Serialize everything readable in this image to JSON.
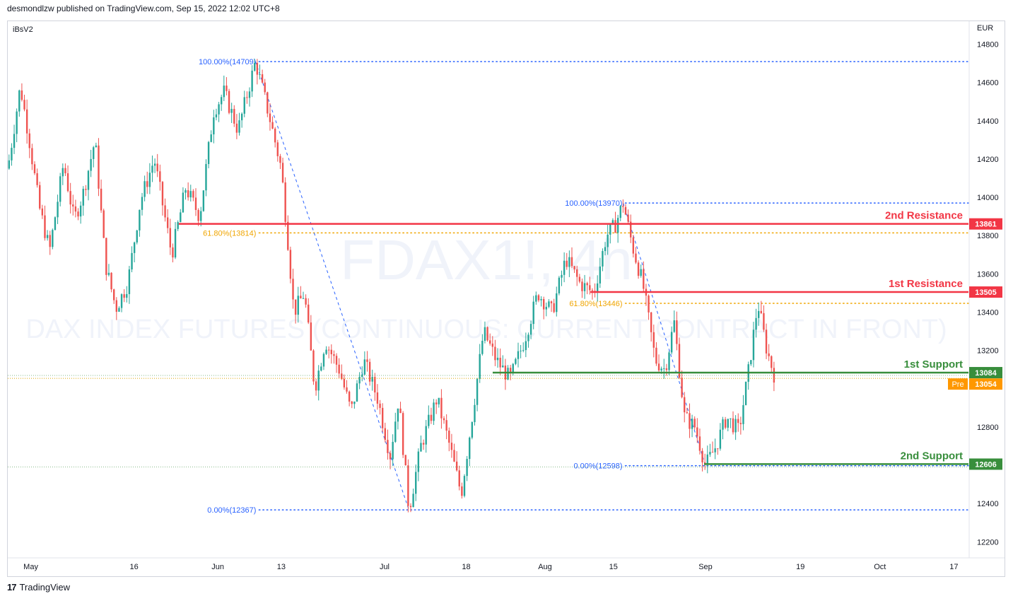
{
  "header": {
    "published": "desmondlzw published on TradingView.com, Sep 15, 2022 12:02 UTC+8"
  },
  "chart_meta": {
    "symbol_tag": "iBsV2",
    "currency": "EUR"
  },
  "watermark": {
    "ticker": "FDAX1!, 4h",
    "description": "DAX INDEX FUTURES (CONTINUOUS: CURRENT CONTRACT IN FRONT)"
  },
  "footer": {
    "brand": "TradingView",
    "logo_icon": "tradingview-logo-icon"
  },
  "colors": {
    "up": "#26a69a",
    "down": "#ef5350",
    "resistance": "#f23645",
    "support": "#388e3c",
    "fib": "#2962ff",
    "fib_mid": "#f0a500",
    "pre": "#ff9800",
    "pre_line": "#d9a400"
  },
  "chart_data": {
    "type": "candlestick",
    "ylim": [
      12120,
      14920
    ],
    "y_ticks": [
      12200,
      12400,
      12600,
      12800,
      13000,
      13200,
      13400,
      13600,
      13800,
      14000,
      14200,
      14400,
      14600,
      14800
    ],
    "y_tick_labels": [
      "12200",
      "12400",
      "12600",
      "12800",
      "",
      "13200",
      "13400",
      "13600",
      "13800",
      "14000",
      "14200",
      "14400",
      "14600",
      "14800"
    ],
    "x_labels": [
      {
        "label": "May",
        "t": 0.033
      },
      {
        "label": "16",
        "t": 0.181
      },
      {
        "label": "Jun",
        "t": 0.301
      },
      {
        "label": "13",
        "t": 0.392
      },
      {
        "label": "Jul",
        "t": 0.54
      },
      {
        "label": "18",
        "t": 0.657
      },
      {
        "label": "Aug",
        "t": 0.77
      },
      {
        "label": "15",
        "t": 0.868
      },
      {
        "label": "Sep",
        "t": 1.0
      },
      {
        "label": "19",
        "t": 1.136
      },
      {
        "label": "Oct",
        "t": 1.25
      },
      {
        "label": "17",
        "t": 1.356
      }
    ],
    "anchors": [
      [
        0.0,
        14150
      ],
      [
        0.018,
        14580
      ],
      [
        0.03,
        14320
      ],
      [
        0.045,
        13950
      ],
      [
        0.06,
        13720
      ],
      [
        0.08,
        14180
      ],
      [
        0.095,
        13880
      ],
      [
        0.108,
        14020
      ],
      [
        0.125,
        14300
      ],
      [
        0.14,
        13650
      ],
      [
        0.155,
        13420
      ],
      [
        0.172,
        13550
      ],
      [
        0.19,
        13980
      ],
      [
        0.21,
        14200
      ],
      [
        0.235,
        13700
      ],
      [
        0.255,
        14050
      ],
      [
        0.275,
        13900
      ],
      [
        0.295,
        14450
      ],
      [
        0.31,
        14550
      ],
      [
        0.33,
        14350
      ],
      [
        0.355,
        14709
      ],
      [
        0.375,
        14420
      ],
      [
        0.392,
        14150
      ],
      [
        0.402,
        13750
      ],
      [
        0.41,
        13400
      ],
      [
        0.425,
        13500
      ],
      [
        0.44,
        13000
      ],
      [
        0.455,
        13250
      ],
      [
        0.475,
        13100
      ],
      [
        0.492,
        12880
      ],
      [
        0.51,
        13150
      ],
      [
        0.53,
        12950
      ],
      [
        0.548,
        12650
      ],
      [
        0.56,
        12950
      ],
      [
        0.575,
        12367
      ],
      [
        0.592,
        12700
      ],
      [
        0.615,
        12950
      ],
      [
        0.632,
        12720
      ],
      [
        0.65,
        12450
      ],
      [
        0.668,
        12920
      ],
      [
        0.682,
        13300
      ],
      [
        0.7,
        13150
      ],
      [
        0.72,
        13050
      ],
      [
        0.74,
        13250
      ],
      [
        0.76,
        13500
      ],
      [
        0.78,
        13400
      ],
      [
        0.8,
        13680
      ],
      [
        0.82,
        13550
      ],
      [
        0.84,
        13500
      ],
      [
        0.858,
        13800
      ],
      [
        0.87,
        13850
      ],
      [
        0.882,
        13970
      ],
      [
        0.895,
        13750
      ],
      [
        0.91,
        13550
      ],
      [
        0.928,
        13150
      ],
      [
        0.942,
        13100
      ],
      [
        0.955,
        13350
      ],
      [
        0.97,
        12850
      ],
      [
        0.985,
        12800
      ],
      [
        1.0,
        12598
      ],
      [
        1.015,
        12700
      ],
      [
        1.03,
        12850
      ],
      [
        1.048,
        12780
      ],
      [
        1.062,
        13100
      ],
      [
        1.075,
        13450
      ],
      [
        1.088,
        13200
      ],
      [
        1.1,
        13054
      ]
    ],
    "levels": [
      {
        "name": "2nd Resistance",
        "value": 13861,
        "label": "2nd Resistance",
        "badge": "13861",
        "kind": "resistance",
        "t_start": 0.245
      },
      {
        "name": "1st Resistance",
        "value": 13505,
        "label": "1st Resistance",
        "badge": "13505",
        "kind": "resistance",
        "t_start": 0.835
      },
      {
        "name": "1st Support",
        "value": 13084,
        "label": "1st Support",
        "badge": "13084",
        "kind": "support",
        "t_start": 0.695
      },
      {
        "name": "2nd Support",
        "value": 12606,
        "label": "2nd Support",
        "badge": "12606",
        "kind": "support",
        "t_start": 0.998
      }
    ],
    "last_price": {
      "value": 13054,
      "badge": "13054",
      "tag": "Pre"
    },
    "fibonacci": [
      {
        "label": "100.00%(14709)",
        "value": 14709,
        "t_label": 0.355,
        "color": "fib"
      },
      {
        "label": "61.80%(13814)",
        "value": 13814,
        "t_label": 0.355,
        "color": "fib_mid"
      },
      {
        "label": "0.00%(12367)",
        "value": 12367,
        "t_label": 0.355,
        "color": "fib"
      },
      {
        "label": "100.00%(13970)",
        "value": 13970,
        "t_label": 0.88,
        "color": "fib"
      },
      {
        "label": "61.80%(13446)",
        "value": 13446,
        "t_label": 0.88,
        "color": "fib_mid"
      },
      {
        "label": "0.00%(12598)",
        "value": 12598,
        "t_label": 0.88,
        "color": "fib"
      }
    ],
    "trend_lines": [
      {
        "from": [
          0.355,
          14709
        ],
        "to": [
          0.575,
          12367
        ]
      },
      {
        "from": [
          0.882,
          13970
        ],
        "to": [
          1.0,
          12598
        ]
      }
    ]
  }
}
